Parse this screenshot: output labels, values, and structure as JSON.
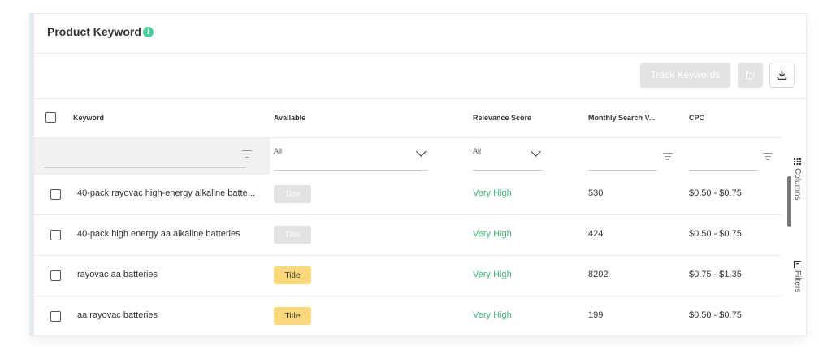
{
  "header": {
    "title": "Product Keyword",
    "info_icon": "i"
  },
  "toolbar": {
    "track_label": "Track Keywords",
    "copy_icon": "copy-icon",
    "download_icon": "download-icon"
  },
  "columns": {
    "keyword": "Keyword",
    "available": "Available",
    "relevance": "Relevance Score",
    "monthly": "Monthly Search V...",
    "cpc": "CPC"
  },
  "filters": {
    "keyword_value": "",
    "available_value": "All",
    "relevance_value": "All",
    "monthly_value": "",
    "cpc_value": ""
  },
  "rows": [
    {
      "keyword": "40-pack rayovac high-energy alkaline batte...",
      "available": "Title",
      "available_state": "disabled",
      "relevance": "Very High",
      "monthly": "530",
      "cpc": "$0.50 - $0.75"
    },
    {
      "keyword": "40-pack high energy aa alkaline batteries",
      "available": "Title",
      "available_state": "disabled",
      "relevance": "Very High",
      "monthly": "424",
      "cpc": "$0.50 - $0.75"
    },
    {
      "keyword": "rayovac aa batteries",
      "available": "Title",
      "available_state": "active",
      "relevance": "Very High",
      "monthly": "8202",
      "cpc": "$0.75 - $1.35"
    },
    {
      "keyword": "aa rayovac batteries",
      "available": "Title",
      "available_state": "active",
      "relevance": "Very High",
      "monthly": "199",
      "cpc": "$0.50 - $0.75"
    }
  ],
  "side_panel": {
    "columns_label": "Columns",
    "filters_label": "Filters"
  },
  "colors": {
    "relevance_green": "#3fb879",
    "badge_active": "#fbd97a",
    "badge_disabled": "#e2e2e2",
    "info_icon": "#4ccf9c"
  }
}
